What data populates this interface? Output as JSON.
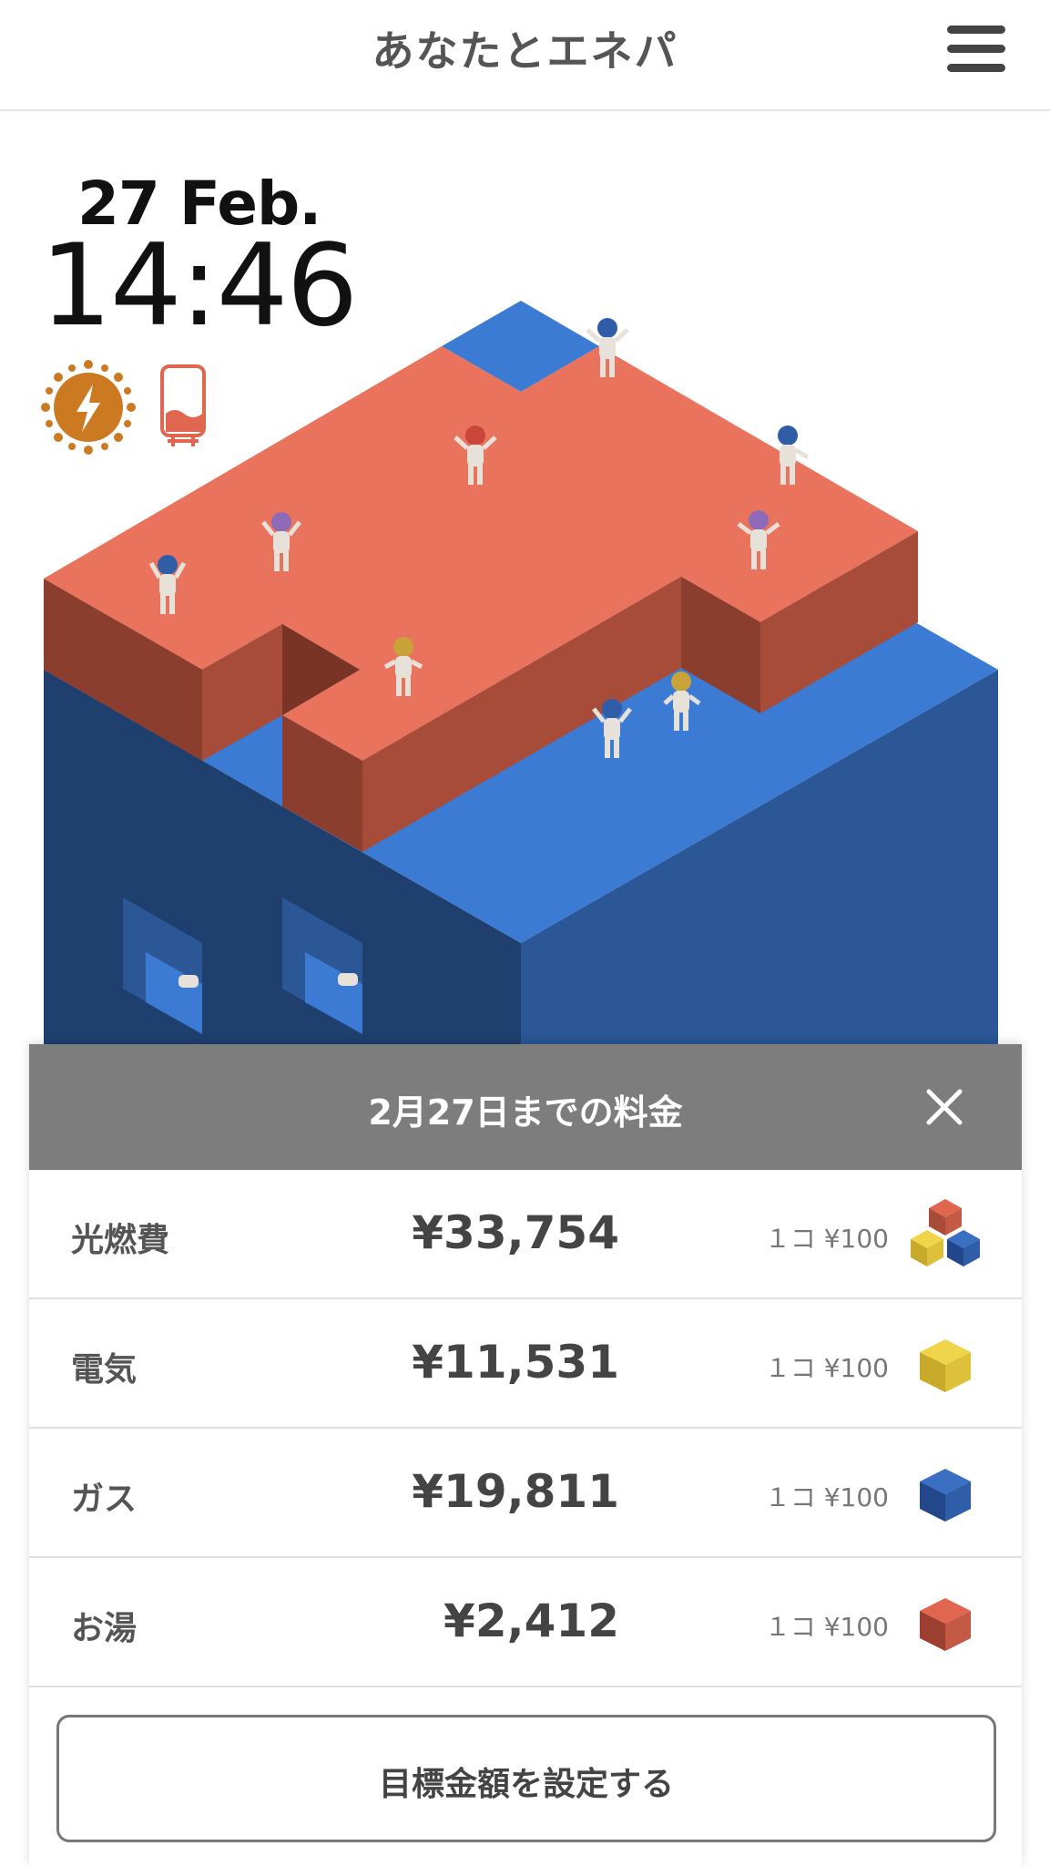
{
  "header": {
    "title": "あなたとエネパ"
  },
  "clock": {
    "date": "27 Feb.",
    "time": "14:46"
  },
  "status_icons": [
    "sun-bolt-icon",
    "hot-water-tank-icon"
  ],
  "panel": {
    "title": "2月27日までの料金",
    "rows": [
      {
        "label": "光燃費",
        "amount": "¥33,754",
        "unit": "１コ ¥100",
        "icon": "mixed-cubes-icon"
      },
      {
        "label": "電気",
        "amount": "¥11,531",
        "unit": "１コ ¥100",
        "icon": "yellow-cube-icon"
      },
      {
        "label": "ガス",
        "amount": "¥19,811",
        "unit": "１コ ¥100",
        "icon": "blue-cube-icon"
      },
      {
        "label": "お湯",
        "amount": "¥2,412",
        "unit": "１コ ¥100",
        "icon": "red-cube-icon"
      }
    ],
    "goal_button": "目標金額を設定する"
  },
  "colors": {
    "red_top": "#ea735d",
    "red_side": "#a84c3a",
    "blue_top": "#3b7bd4",
    "blue_side": "#2b5796",
    "blue_dark": "#1f3f6e",
    "sun": "#cc7a22",
    "tank": "#e0664f"
  }
}
